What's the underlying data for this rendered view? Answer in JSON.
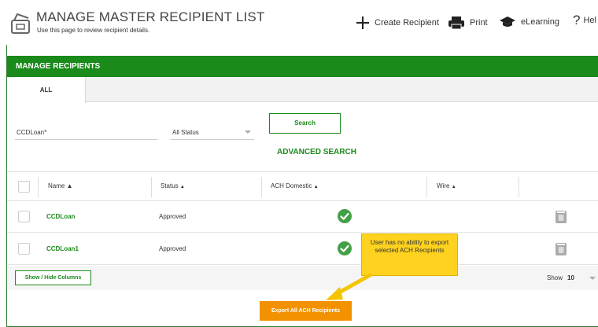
{
  "header": {
    "title": "MANAGE MASTER RECIPIENT LIST",
    "subtitle": "Use this page to review recipient details.",
    "actions": [
      {
        "label": "Create Recipient",
        "icon": "plus-icon"
      },
      {
        "label": "Print",
        "icon": "printer-icon"
      },
      {
        "label": "eLearning",
        "icon": "graduation-cap-icon"
      },
      {
        "label": "Hel",
        "icon": "help-question-icon"
      }
    ]
  },
  "section": {
    "title": "MANAGE RECIPIENTS"
  },
  "tabs": [
    {
      "label": "ALL"
    }
  ],
  "filters": {
    "search_value": "CCDLoan*",
    "status_value": "All Status",
    "search_button": "Search",
    "advanced_search": "ADVANCED SEARCH"
  },
  "table": {
    "columns": [
      {
        "label": "Name",
        "sort": "▲"
      },
      {
        "label": "Status",
        "sort": "▲"
      },
      {
        "label": "ACH Domestic",
        "sort": "▲"
      },
      {
        "label": "Wire",
        "sort": "▲"
      }
    ],
    "rows": [
      {
        "name": "CCDLoan",
        "status": "Approved",
        "ach": "check-circle-icon"
      },
      {
        "name": "CCDLoan1",
        "status": "Approved",
        "ach": "check-circle-icon"
      }
    ]
  },
  "footer": {
    "show_hide_button": "Show / Hide Columns",
    "show_label": "Show",
    "show_value": "10"
  },
  "export_button": "Export All ACH Recipients",
  "callout": "User has no ability to export selected ACH Recipients",
  "colors": {
    "green": "#1a8a1a",
    "orange": "#f39200",
    "callout": "#ffd21f"
  }
}
